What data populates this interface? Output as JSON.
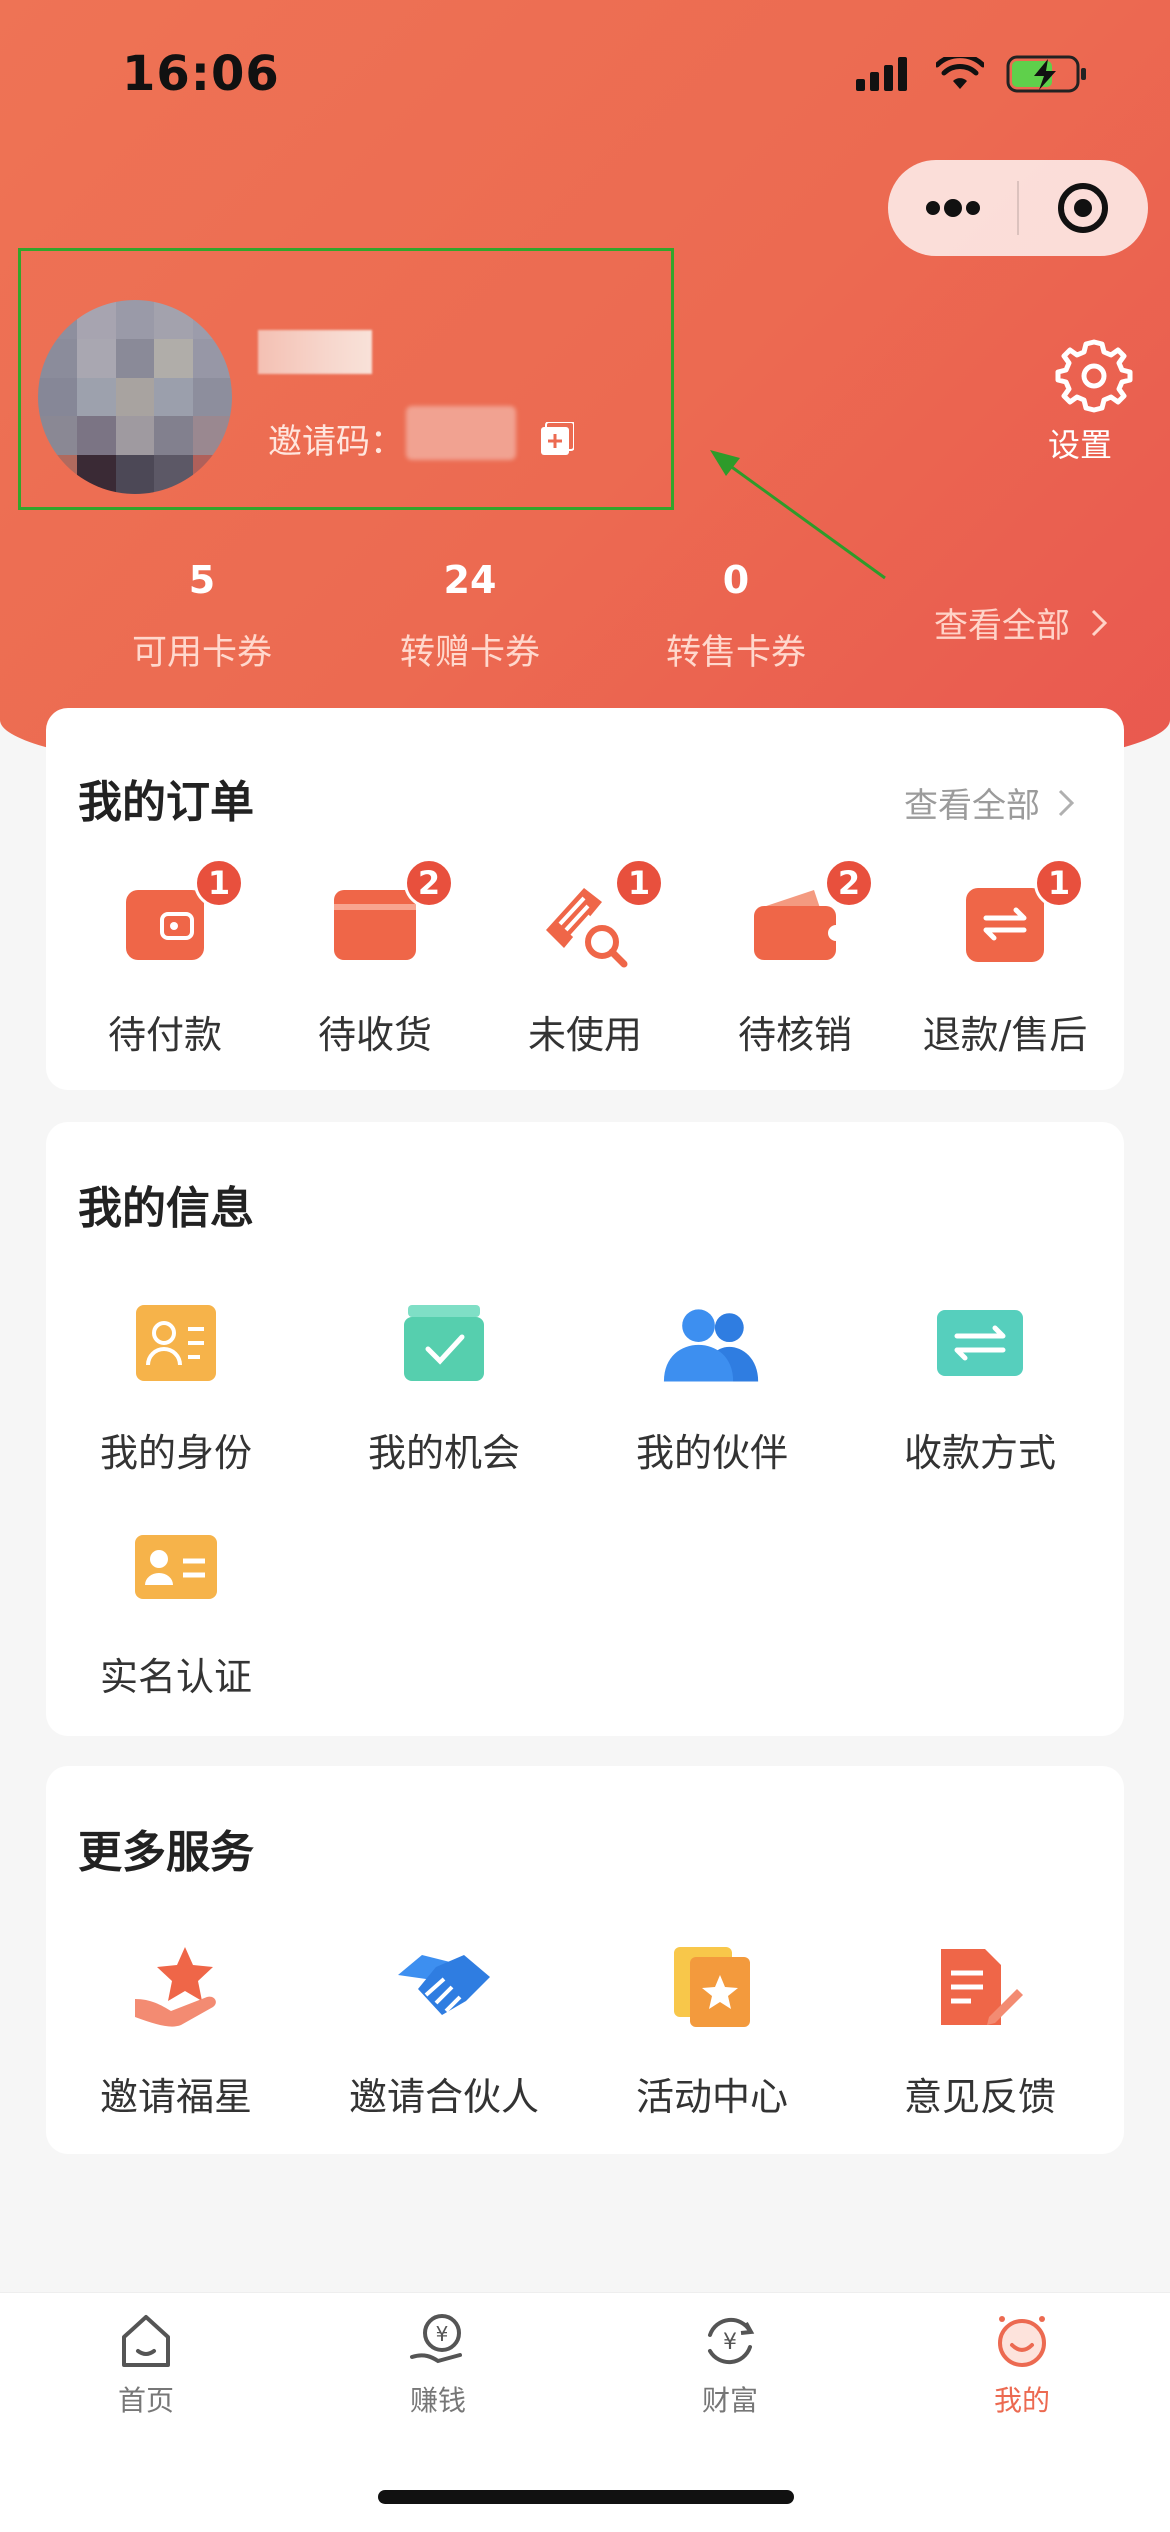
{
  "status_bar": {
    "time": "16:06"
  },
  "profile": {
    "invite_label": "邀请码：",
    "settings_label": "设置"
  },
  "stats": [
    {
      "value": "5",
      "label": "可用卡券"
    },
    {
      "value": "24",
      "label": "转赠卡券"
    },
    {
      "value": "0",
      "label": "转售卡券"
    }
  ],
  "stats_see_all": "查看全部",
  "orders": {
    "title": "我的订单",
    "see_all": "查看全部",
    "items": [
      {
        "label": "待付款",
        "badge": "1"
      },
      {
        "label": "待收货",
        "badge": "2"
      },
      {
        "label": "未使用",
        "badge": "1"
      },
      {
        "label": "待核销",
        "badge": "2"
      },
      {
        "label": "退款/售后",
        "badge": "1"
      }
    ]
  },
  "info": {
    "title": "我的信息",
    "items": [
      {
        "label": "我的身份"
      },
      {
        "label": "我的机会"
      },
      {
        "label": "我的伙伴"
      },
      {
        "label": "收款方式"
      },
      {
        "label": "实名认证"
      }
    ]
  },
  "services": {
    "title": "更多服务",
    "items": [
      {
        "label": "邀请福星"
      },
      {
        "label": "邀请合伙人"
      },
      {
        "label": "活动中心"
      },
      {
        "label": "意见反馈"
      }
    ]
  },
  "tabbar": [
    {
      "label": "首页"
    },
    {
      "label": "赚钱"
    },
    {
      "label": "财富"
    },
    {
      "label": "我的"
    }
  ],
  "colors": {
    "brand": "#ec6a51",
    "badge": "#e8503d",
    "highlight_box": "#33a52b"
  }
}
